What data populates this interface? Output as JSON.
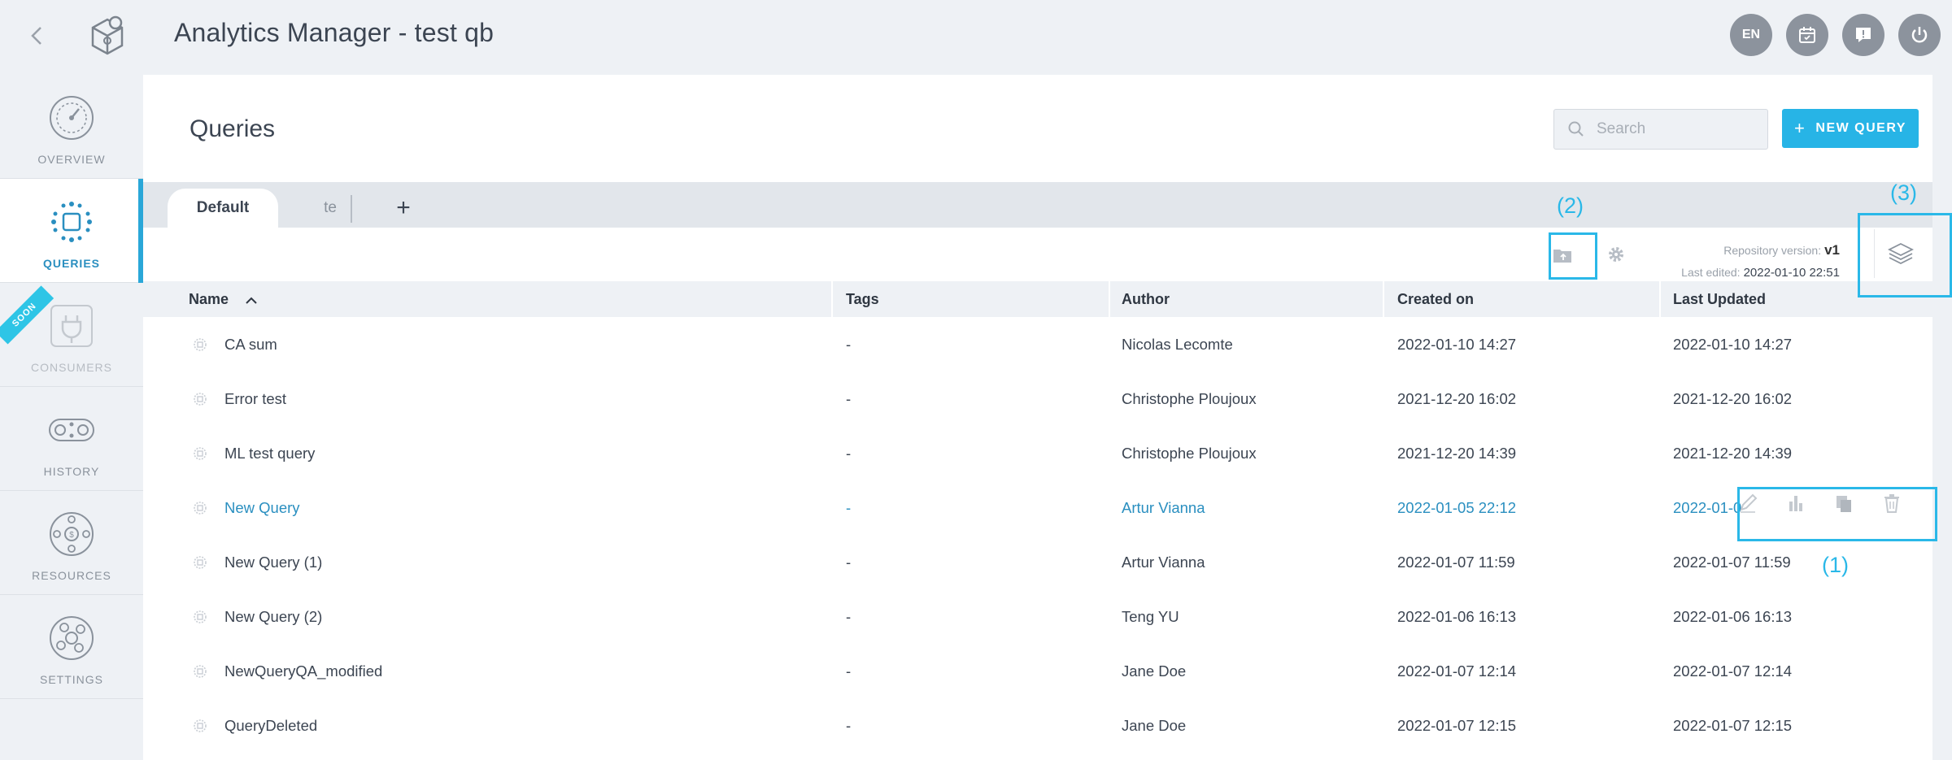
{
  "app": {
    "title": "Analytics Manager - test qb",
    "language_badge": "EN"
  },
  "sidebar": {
    "items": [
      {
        "label": "OVERVIEW"
      },
      {
        "label": "QUERIES"
      },
      {
        "label": "CONSUMERS",
        "ribbon": "SOON"
      },
      {
        "label": "HISTORY"
      },
      {
        "label": "RESOURCES"
      },
      {
        "label": "SETTINGS"
      }
    ]
  },
  "header": {
    "page_title": "Queries",
    "search_placeholder": "Search",
    "new_query_label": "NEW QUERY"
  },
  "tabs": [
    {
      "label": "Default"
    },
    {
      "label": "te"
    }
  ],
  "repository": {
    "version_label": "Repository version:",
    "version_value": "v1",
    "edited_label": "Last edited:",
    "edited_value": "2022-01-10 22:51"
  },
  "table": {
    "columns": [
      "Name",
      "Tags",
      "Author",
      "Created on",
      "Last Updated"
    ],
    "sort_indicator": "ascending",
    "rows": [
      {
        "name": "CA sum",
        "tags": "-",
        "author": "Nicolas Lecomte",
        "created": "2022-01-10 14:27",
        "updated": "2022-01-10 14:27"
      },
      {
        "name": "Error test",
        "tags": "-",
        "author": "Christophe Ploujoux",
        "created": "2021-12-20 16:02",
        "updated": "2021-12-20 16:02"
      },
      {
        "name": "ML test query",
        "tags": "-",
        "author": "Christophe Ploujoux",
        "created": "2021-12-20 14:39",
        "updated": "2021-12-20 14:39"
      },
      {
        "name": "New Query",
        "tags": "-",
        "author": "Artur Vianna",
        "created": "2022-01-05 22:12",
        "updated": "2022-01-0"
      },
      {
        "name": "New Query (1)",
        "tags": "-",
        "author": "Artur Vianna",
        "created": "2022-01-07 11:59",
        "updated": "2022-01-07 11:59"
      },
      {
        "name": "New Query (2)",
        "tags": "-",
        "author": "Teng YU",
        "created": "2022-01-06 16:13",
        "updated": "2022-01-06 16:13"
      },
      {
        "name": "NewQueryQA_modified",
        "tags": "-",
        "author": "Jane Doe",
        "created": "2022-01-07 12:14",
        "updated": "2022-01-07 12:14"
      },
      {
        "name": "QueryDeleted",
        "tags": "-",
        "author": "Jane Doe",
        "created": "2022-01-07 12:15",
        "updated": "2022-01-07 12:15"
      }
    ]
  },
  "annotations": {
    "one": "(1)",
    "two": "(2)",
    "three": "(3)"
  },
  "colors": {
    "accent": "#27b4e6",
    "annotation": "#2ab8e8",
    "link": "#2a8fc0"
  },
  "icons": {
    "top_actions": [
      "language-badge",
      "calendar-icon",
      "feedback-icon",
      "power-icon"
    ],
    "row_actions": [
      "edit-icon",
      "chart-icon",
      "duplicate-icon",
      "delete-icon"
    ]
  }
}
